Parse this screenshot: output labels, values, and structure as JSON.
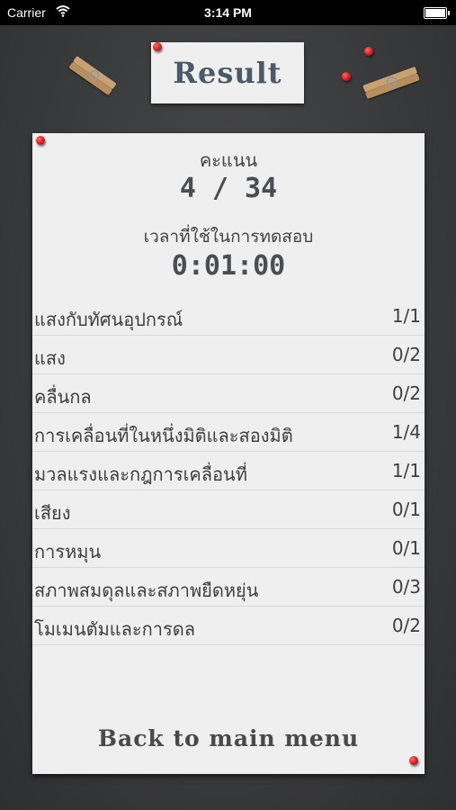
{
  "status_bar": {
    "carrier": "Carrier",
    "time": "3:14 PM"
  },
  "title": "Result",
  "score": {
    "label": "คะแนน",
    "value": "4 / 34"
  },
  "time_used": {
    "label": "เวลาที่ใช้ในการทดสอบ",
    "value": "0:01:00"
  },
  "topics": [
    {
      "name": "แสงกับทัศนอุปกรณ์",
      "score": "1/1"
    },
    {
      "name": "แสง",
      "score": "0/2"
    },
    {
      "name": "คลื่นกล",
      "score": "0/2"
    },
    {
      "name": "การเคลื่อนที่ในหนึ่งมิติและสองมิติ",
      "score": "1/4"
    },
    {
      "name": "มวลแรงและกฎการเคลื่อนที่",
      "score": "1/1"
    },
    {
      "name": "เสียง",
      "score": "0/1"
    },
    {
      "name": "การหมุน",
      "score": "0/1"
    },
    {
      "name": "สภาพสมดุลและสภาพยืดหยุ่น",
      "score": "0/3"
    },
    {
      "name": "โมเมนตัมและการดล",
      "score": "0/2"
    }
  ],
  "back_button": "Back to main menu",
  "colors": {
    "chalkboard": "#3a3b3d",
    "paper": "#efefef",
    "pin": "#d11e1e",
    "title_text": "#4c5a68"
  }
}
